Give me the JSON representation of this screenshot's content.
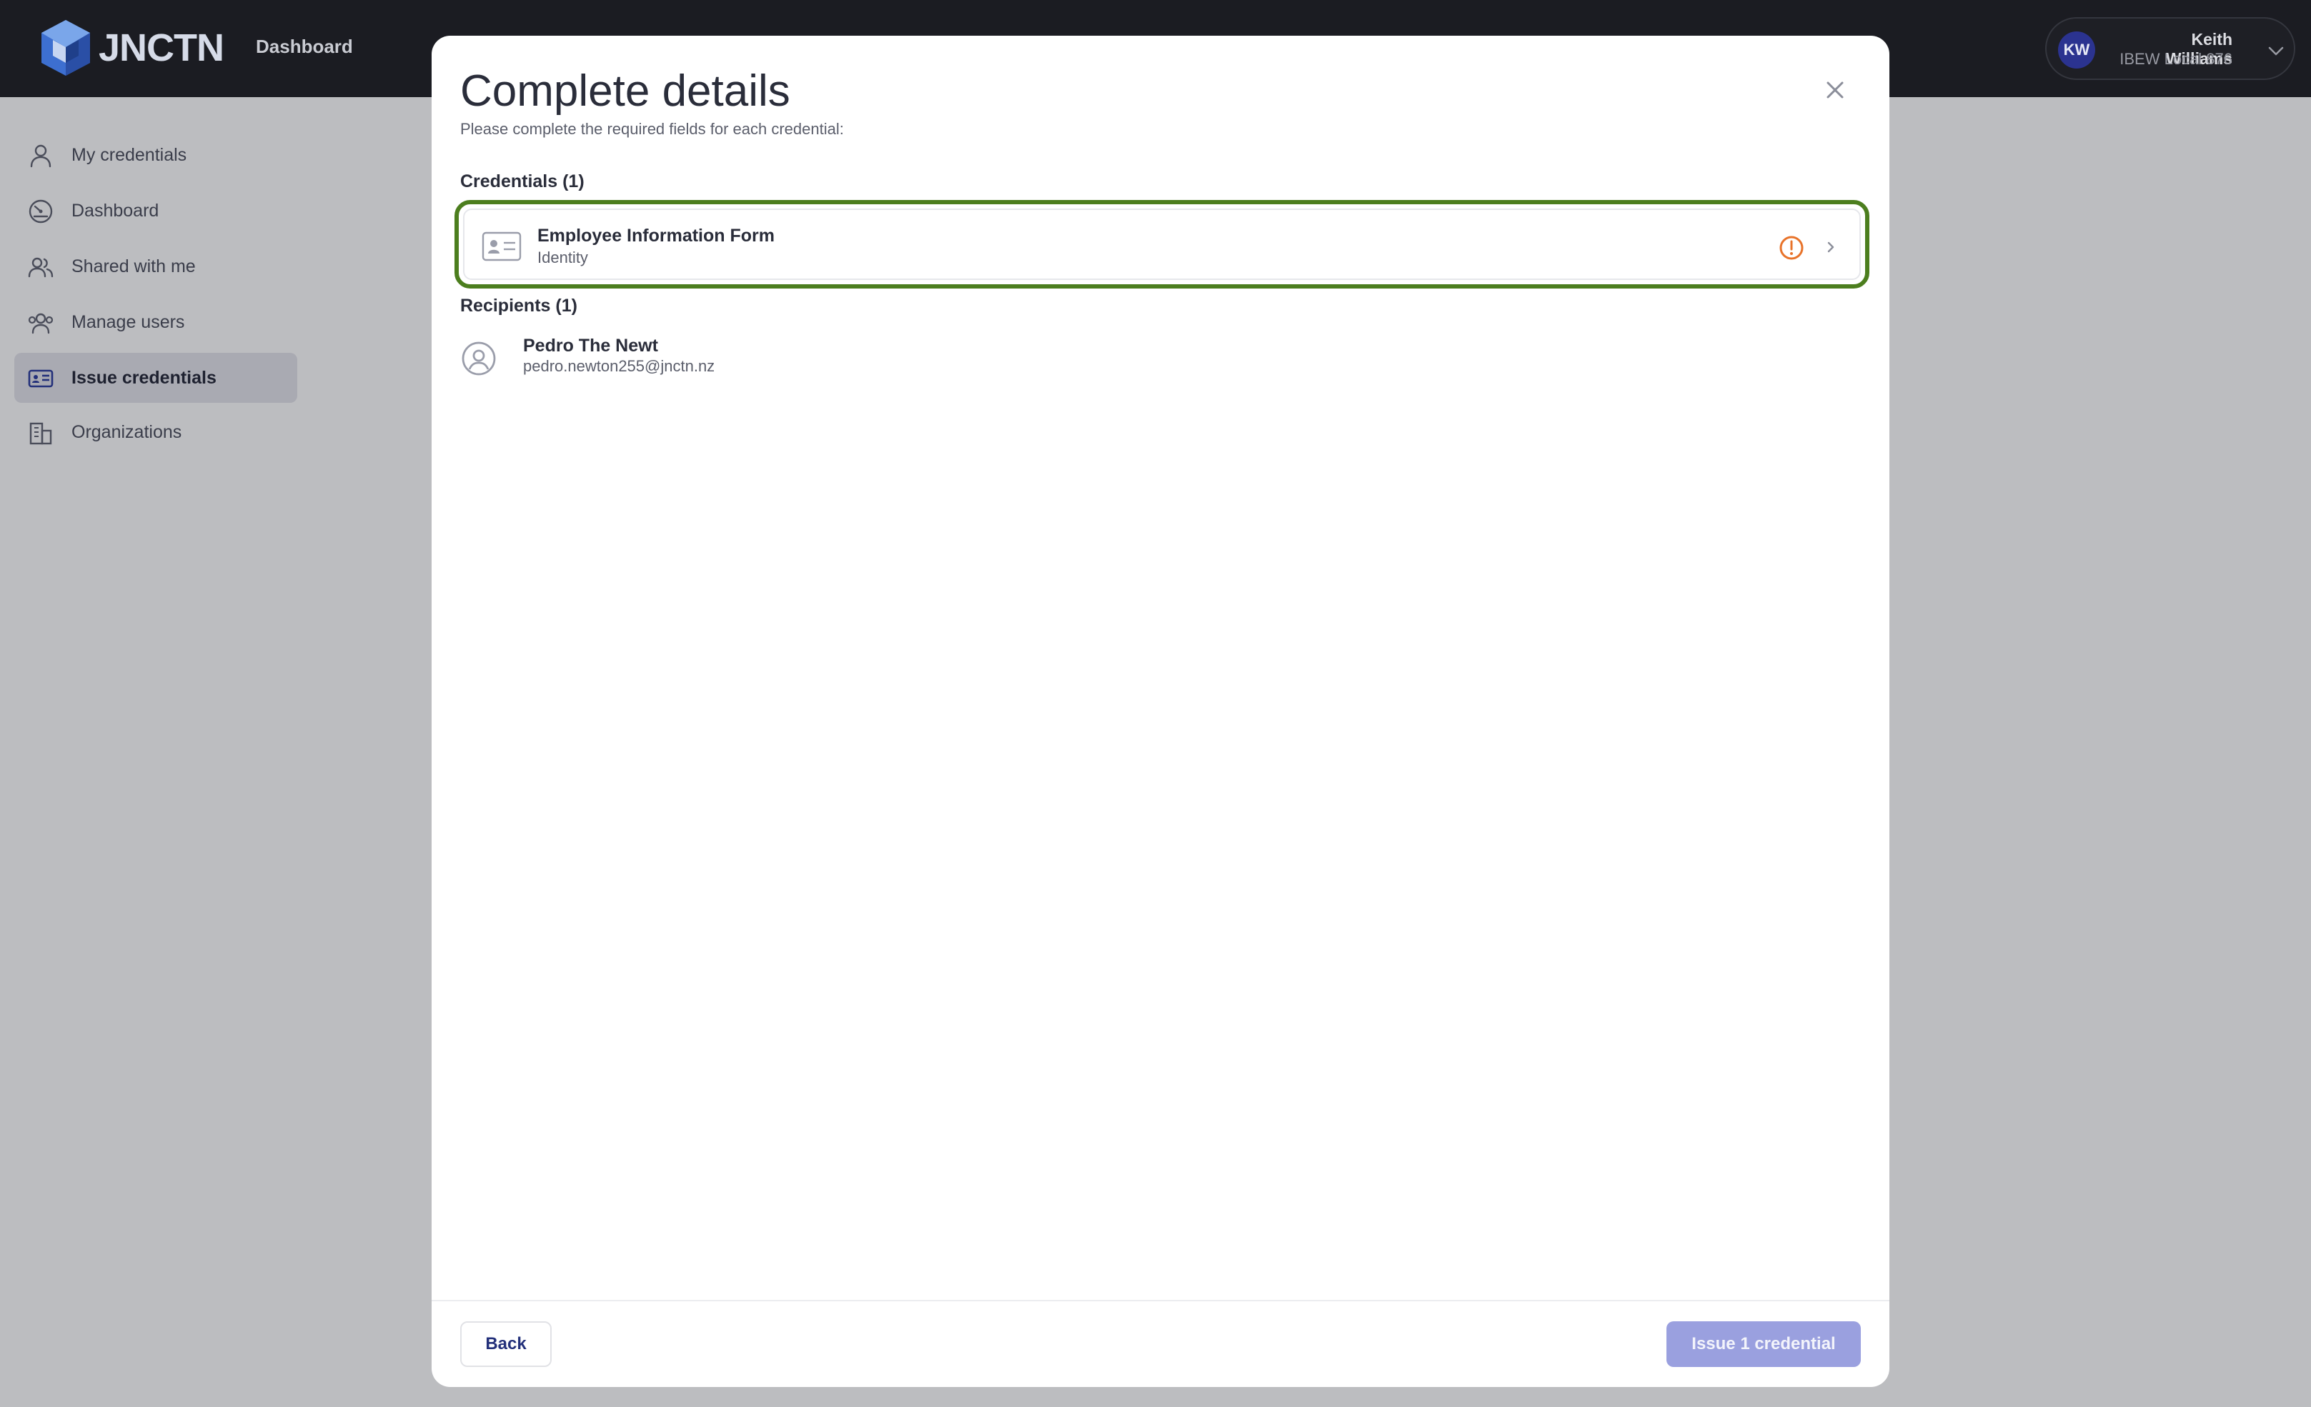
{
  "topbar": {
    "logo_text": "JNCTN",
    "nav_label": "Dashboard",
    "user": {
      "initials": "KW",
      "name": "Keith Williams",
      "org": "IBEW Local 876"
    }
  },
  "sidebar": {
    "items": [
      {
        "label": "My credentials",
        "icon": "person-icon",
        "active": false
      },
      {
        "label": "Dashboard",
        "icon": "dashboard-gauge-icon",
        "active": false
      },
      {
        "label": "Shared with me",
        "icon": "people-icon",
        "active": false
      },
      {
        "label": "Manage users",
        "icon": "users-gear-icon",
        "active": false
      },
      {
        "label": "Issue credentials",
        "icon": "id-card-icon",
        "active": true
      },
      {
        "label": "Organizations",
        "icon": "building-icon",
        "active": false
      }
    ]
  },
  "modal": {
    "title": "Complete details",
    "subtitle": "Please complete the required fields for each credential:",
    "credentials_label": "Credentials (1)",
    "credentials": [
      {
        "name": "Employee Information Form",
        "type": "Identity",
        "status_icon": "warning-circle-icon"
      }
    ],
    "recipients_label": "Recipients (1)",
    "recipients": [
      {
        "name": "Pedro The Newt",
        "email": "pedro.newton255@jnctn.nz"
      }
    ],
    "back_label": "Back",
    "issue_label": "Issue 1 credential"
  },
  "colors": {
    "topbar_bg": "#1b1c22",
    "overlay_bg": "#bcbdc0",
    "highlight_border": "#4c7e1e",
    "warning": "#e8732a",
    "primary_button": "#9aa0df",
    "avatar_bg": "#2b3390"
  }
}
